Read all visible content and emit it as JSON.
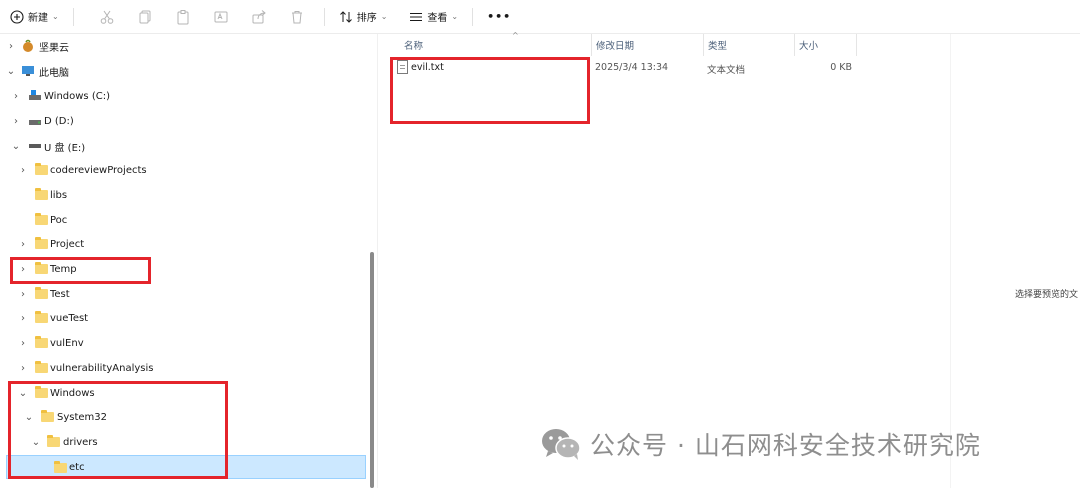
{
  "toolbar": {
    "new_label": "新建",
    "sort_label": "排序",
    "view_label": "查看",
    "more_label": "•••"
  },
  "nav": {
    "items": [
      {
        "label": "坚果云",
        "icon": "nut-icon",
        "expander": ">"
      },
      {
        "label": "此电脑",
        "icon": "computer-icon",
        "expander": "v"
      },
      {
        "label": "Windows  (C:)",
        "icon": "drive-icon",
        "expander": ">"
      },
      {
        "label": "D    (D:)",
        "icon": "drive-icon",
        "expander": ">"
      },
      {
        "label": "U 盘 (E:)",
        "icon": "usb-drive-icon",
        "expander": "v"
      },
      {
        "label": "codereviewProjects",
        "icon": "folder-icon",
        "expander": ">"
      },
      {
        "label": "libs",
        "icon": "folder-icon",
        "expander": ""
      },
      {
        "label": "Poc",
        "icon": "folder-icon",
        "expander": ""
      },
      {
        "label": "Project",
        "icon": "folder-icon",
        "expander": ">"
      },
      {
        "label": "Temp",
        "icon": "folder-icon",
        "expander": ">"
      },
      {
        "label": "Test",
        "icon": "folder-icon",
        "expander": ">"
      },
      {
        "label": "vueTest",
        "icon": "folder-icon",
        "expander": ">"
      },
      {
        "label": "vulEnv",
        "icon": "folder-icon",
        "expander": ">"
      },
      {
        "label": "vulnerabilityAnalysis",
        "icon": "folder-icon",
        "expander": ">"
      },
      {
        "label": "Windows",
        "icon": "folder-icon",
        "expander": "v"
      },
      {
        "label": "System32",
        "icon": "folder-icon",
        "expander": "v"
      },
      {
        "label": "drivers",
        "icon": "folder-icon",
        "expander": "v"
      },
      {
        "label": "etc",
        "icon": "folder-icon",
        "expander": ""
      }
    ]
  },
  "content": {
    "columns": [
      "名称",
      "修改日期",
      "类型",
      "大小"
    ],
    "files": [
      {
        "name": "evil.txt",
        "modified": "2025/3/4 13:34",
        "type": "文本文档",
        "size": "0 KB"
      }
    ]
  },
  "preview": {
    "text": "选择要预览的文"
  },
  "watermark": {
    "text": "公众号 · 山石网科安全技术研究院"
  },
  "colors": {
    "highlight": "#e4242b",
    "selection": "#cce8ff",
    "folder": "#f8d775"
  }
}
